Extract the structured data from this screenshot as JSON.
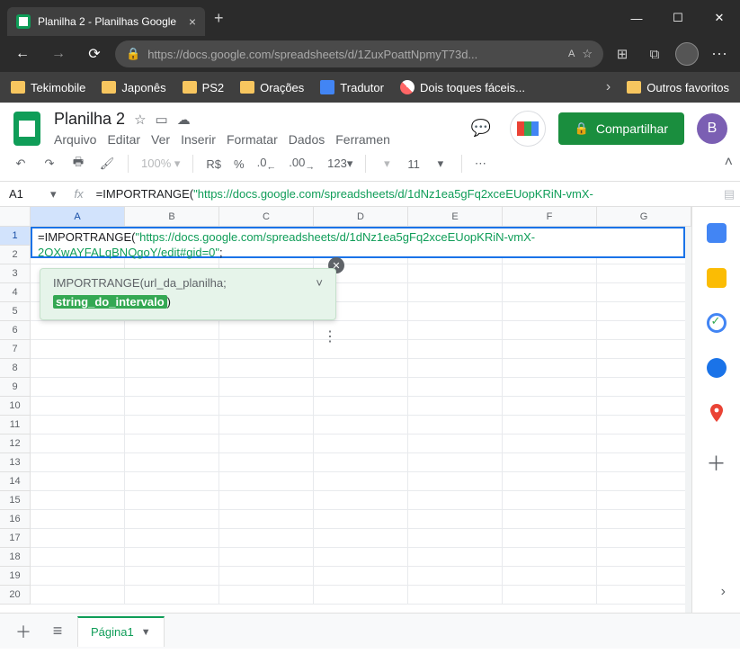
{
  "browser": {
    "tab_title": "Planilha 2 - Planilhas Google",
    "url": "https://docs.google.com/spreadsheets/d/1ZuxPoattNpmyT73d...",
    "url_readas": "A"
  },
  "bookmarks": [
    "Tekimobile",
    "Japonês",
    "PS2",
    "Orações",
    "Tradutor",
    "Dois toques fáceis...",
    "Outros favoritos"
  ],
  "sheets": {
    "doc_title": "Planilha 2",
    "menus": [
      "Arquivo",
      "Editar",
      "Ver",
      "Inserir",
      "Formatar",
      "Dados",
      "Ferramen"
    ],
    "share_label": "Compartilhar",
    "user_initial": "B"
  },
  "toolbar": {
    "zoom": "100%",
    "currency": "R$",
    "percent": "%",
    "dec_dec": ".0",
    "dec_inc": ".00",
    "numfmt": "123",
    "fontsize": "11"
  },
  "formula_bar": {
    "cell_ref": "A1",
    "formula_prefix": "=IMPORTRANGE(",
    "formula_url": "\"https://docs.google.com/spreadsheets/d/1dNz1ea5gFq2xceEUopKRiN-vmX-"
  },
  "edit_cell": {
    "line1_prefix": "=IMPORTRANGE(",
    "line1_url": "\"https://docs.google.com/spreadsheets/d/1dNz1ea5gFq2xceEUopKRiN-vmX-",
    "line2_url": "2OXwAYFALqBNQgoY/edit#gid=0\"",
    "line2_tail": ";"
  },
  "hint": {
    "fn": "IMPORTRANGE",
    "arg1": "url_da_planilha",
    "arg2": "string_do_intervalo"
  },
  "grid": {
    "columns": [
      "A",
      "B",
      "C",
      "D",
      "E",
      "F",
      "G"
    ],
    "rows": 20
  },
  "sheet_tab": "Página1"
}
